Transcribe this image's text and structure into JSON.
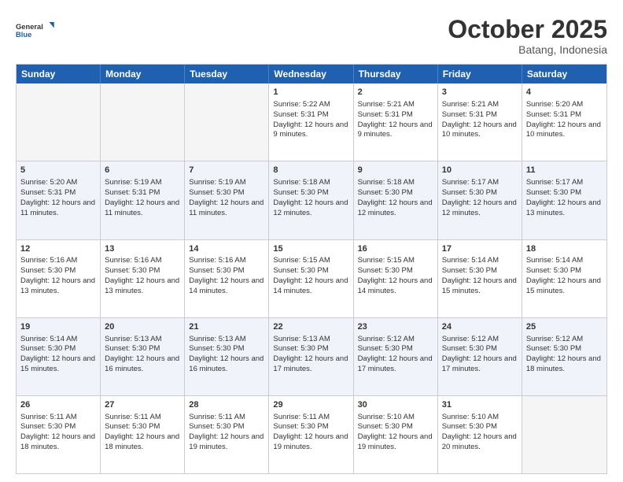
{
  "header": {
    "logo_line1": "General",
    "logo_line2": "Blue",
    "month": "October 2025",
    "location": "Batang, Indonesia"
  },
  "days_of_week": [
    "Sunday",
    "Monday",
    "Tuesday",
    "Wednesday",
    "Thursday",
    "Friday",
    "Saturday"
  ],
  "rows": [
    [
      {
        "day": "",
        "sunrise": "",
        "sunset": "",
        "daylight": ""
      },
      {
        "day": "",
        "sunrise": "",
        "sunset": "",
        "daylight": ""
      },
      {
        "day": "",
        "sunrise": "",
        "sunset": "",
        "daylight": ""
      },
      {
        "day": "1",
        "sunrise": "Sunrise: 5:22 AM",
        "sunset": "Sunset: 5:31 PM",
        "daylight": "Daylight: 12 hours and 9 minutes."
      },
      {
        "day": "2",
        "sunrise": "Sunrise: 5:21 AM",
        "sunset": "Sunset: 5:31 PM",
        "daylight": "Daylight: 12 hours and 9 minutes."
      },
      {
        "day": "3",
        "sunrise": "Sunrise: 5:21 AM",
        "sunset": "Sunset: 5:31 PM",
        "daylight": "Daylight: 12 hours and 10 minutes."
      },
      {
        "day": "4",
        "sunrise": "Sunrise: 5:20 AM",
        "sunset": "Sunset: 5:31 PM",
        "daylight": "Daylight: 12 hours and 10 minutes."
      }
    ],
    [
      {
        "day": "5",
        "sunrise": "Sunrise: 5:20 AM",
        "sunset": "Sunset: 5:31 PM",
        "daylight": "Daylight: 12 hours and 11 minutes."
      },
      {
        "day": "6",
        "sunrise": "Sunrise: 5:19 AM",
        "sunset": "Sunset: 5:31 PM",
        "daylight": "Daylight: 12 hours and 11 minutes."
      },
      {
        "day": "7",
        "sunrise": "Sunrise: 5:19 AM",
        "sunset": "Sunset: 5:30 PM",
        "daylight": "Daylight: 12 hours and 11 minutes."
      },
      {
        "day": "8",
        "sunrise": "Sunrise: 5:18 AM",
        "sunset": "Sunset: 5:30 PM",
        "daylight": "Daylight: 12 hours and 12 minutes."
      },
      {
        "day": "9",
        "sunrise": "Sunrise: 5:18 AM",
        "sunset": "Sunset: 5:30 PM",
        "daylight": "Daylight: 12 hours and 12 minutes."
      },
      {
        "day": "10",
        "sunrise": "Sunrise: 5:17 AM",
        "sunset": "Sunset: 5:30 PM",
        "daylight": "Daylight: 12 hours and 12 minutes."
      },
      {
        "day": "11",
        "sunrise": "Sunrise: 5:17 AM",
        "sunset": "Sunset: 5:30 PM",
        "daylight": "Daylight: 12 hours and 13 minutes."
      }
    ],
    [
      {
        "day": "12",
        "sunrise": "Sunrise: 5:16 AM",
        "sunset": "Sunset: 5:30 PM",
        "daylight": "Daylight: 12 hours and 13 minutes."
      },
      {
        "day": "13",
        "sunrise": "Sunrise: 5:16 AM",
        "sunset": "Sunset: 5:30 PM",
        "daylight": "Daylight: 12 hours and 13 minutes."
      },
      {
        "day": "14",
        "sunrise": "Sunrise: 5:16 AM",
        "sunset": "Sunset: 5:30 PM",
        "daylight": "Daylight: 12 hours and 14 minutes."
      },
      {
        "day": "15",
        "sunrise": "Sunrise: 5:15 AM",
        "sunset": "Sunset: 5:30 PM",
        "daylight": "Daylight: 12 hours and 14 minutes."
      },
      {
        "day": "16",
        "sunrise": "Sunrise: 5:15 AM",
        "sunset": "Sunset: 5:30 PM",
        "daylight": "Daylight: 12 hours and 14 minutes."
      },
      {
        "day": "17",
        "sunrise": "Sunrise: 5:14 AM",
        "sunset": "Sunset: 5:30 PM",
        "daylight": "Daylight: 12 hours and 15 minutes."
      },
      {
        "day": "18",
        "sunrise": "Sunrise: 5:14 AM",
        "sunset": "Sunset: 5:30 PM",
        "daylight": "Daylight: 12 hours and 15 minutes."
      }
    ],
    [
      {
        "day": "19",
        "sunrise": "Sunrise: 5:14 AM",
        "sunset": "Sunset: 5:30 PM",
        "daylight": "Daylight: 12 hours and 15 minutes."
      },
      {
        "day": "20",
        "sunrise": "Sunrise: 5:13 AM",
        "sunset": "Sunset: 5:30 PM",
        "daylight": "Daylight: 12 hours and 16 minutes."
      },
      {
        "day": "21",
        "sunrise": "Sunrise: 5:13 AM",
        "sunset": "Sunset: 5:30 PM",
        "daylight": "Daylight: 12 hours and 16 minutes."
      },
      {
        "day": "22",
        "sunrise": "Sunrise: 5:13 AM",
        "sunset": "Sunset: 5:30 PM",
        "daylight": "Daylight: 12 hours and 17 minutes."
      },
      {
        "day": "23",
        "sunrise": "Sunrise: 5:12 AM",
        "sunset": "Sunset: 5:30 PM",
        "daylight": "Daylight: 12 hours and 17 minutes."
      },
      {
        "day": "24",
        "sunrise": "Sunrise: 5:12 AM",
        "sunset": "Sunset: 5:30 PM",
        "daylight": "Daylight: 12 hours and 17 minutes."
      },
      {
        "day": "25",
        "sunrise": "Sunrise: 5:12 AM",
        "sunset": "Sunset: 5:30 PM",
        "daylight": "Daylight: 12 hours and 18 minutes."
      }
    ],
    [
      {
        "day": "26",
        "sunrise": "Sunrise: 5:11 AM",
        "sunset": "Sunset: 5:30 PM",
        "daylight": "Daylight: 12 hours and 18 minutes."
      },
      {
        "day": "27",
        "sunrise": "Sunrise: 5:11 AM",
        "sunset": "Sunset: 5:30 PM",
        "daylight": "Daylight: 12 hours and 18 minutes."
      },
      {
        "day": "28",
        "sunrise": "Sunrise: 5:11 AM",
        "sunset": "Sunset: 5:30 PM",
        "daylight": "Daylight: 12 hours and 19 minutes."
      },
      {
        "day": "29",
        "sunrise": "Sunrise: 5:11 AM",
        "sunset": "Sunset: 5:30 PM",
        "daylight": "Daylight: 12 hours and 19 minutes."
      },
      {
        "day": "30",
        "sunrise": "Sunrise: 5:10 AM",
        "sunset": "Sunset: 5:30 PM",
        "daylight": "Daylight: 12 hours and 19 minutes."
      },
      {
        "day": "31",
        "sunrise": "Sunrise: 5:10 AM",
        "sunset": "Sunset: 5:30 PM",
        "daylight": "Daylight: 12 hours and 20 minutes."
      },
      {
        "day": "",
        "sunrise": "",
        "sunset": "",
        "daylight": ""
      }
    ]
  ]
}
